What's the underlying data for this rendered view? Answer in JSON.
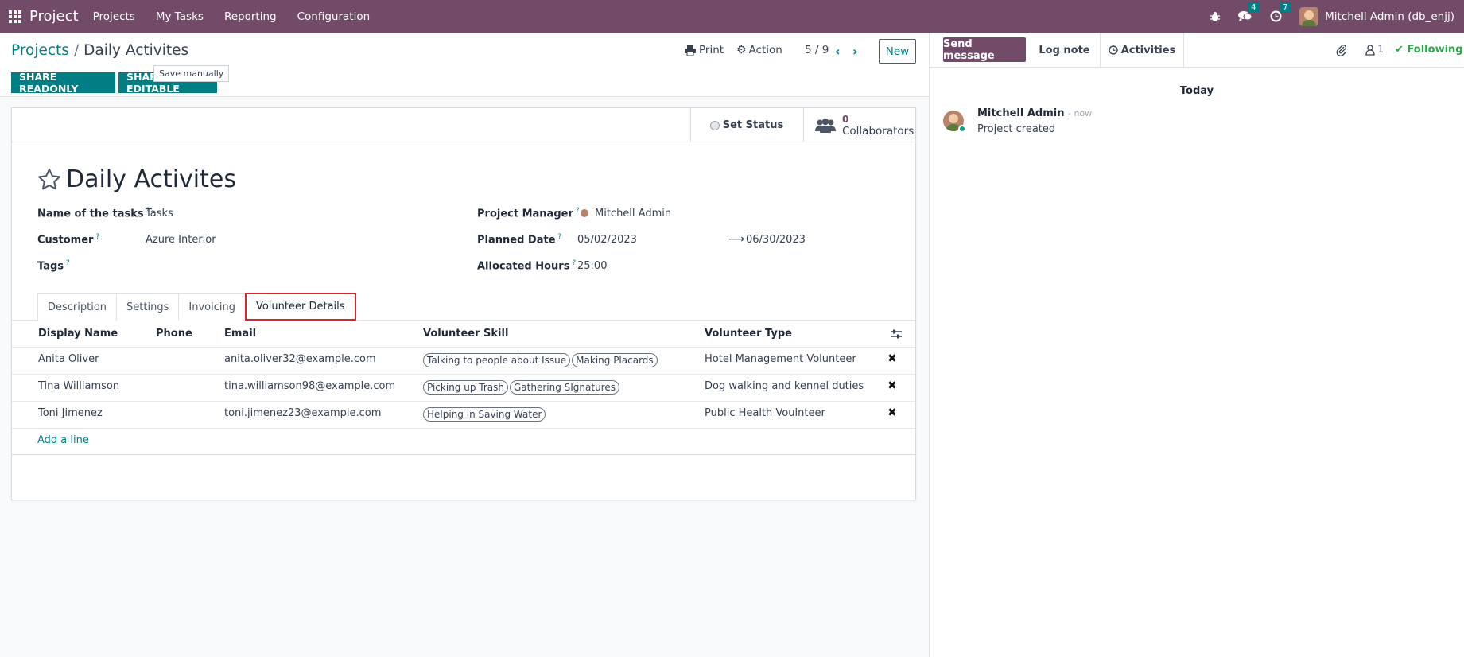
{
  "navbar": {
    "brand": "Project",
    "menu": [
      "Projects",
      "My Tasks",
      "Reporting",
      "Configuration"
    ],
    "messages_count": "4",
    "activities_count": "7",
    "user": "Mitchell Admin (db_enjj)"
  },
  "control": {
    "breadcrumb_parent": "Projects",
    "breadcrumb_sep": "/",
    "breadcrumb_current": "Daily Activites",
    "tooltip": "Save manually",
    "share_readonly": "SHARE READONLY",
    "share_editable": "SHARE EDITABLE",
    "print": "Print",
    "action": "Action",
    "pager": "5 / 9",
    "new": "New"
  },
  "sheet": {
    "set_status": "Set Status",
    "collaborators_count": "0",
    "collaborators_label": "Collaborators",
    "title": "Daily Activites",
    "fields": {
      "tasks_label": "Name of the tasks",
      "tasks_value": "Tasks",
      "customer_label": "Customer",
      "customer_value": "Azure Interior",
      "tags_label": "Tags",
      "pm_label": "Project Manager",
      "pm_value": "Mitchell Admin",
      "planned_label": "Planned Date",
      "planned_start": "05/02/2023",
      "planned_end": "06/30/2023",
      "hours_label": "Allocated Hours",
      "hours_value": "25:00",
      "help_mark": "?"
    },
    "tabs": [
      "Description",
      "Settings",
      "Invoicing",
      "Volunteer Details"
    ],
    "table": {
      "headers": [
        "Display Name",
        "Phone",
        "Email",
        "Volunteer Skill",
        "Volunteer Type"
      ],
      "rows": [
        {
          "name": "Anita Oliver",
          "phone": "",
          "email": "anita.oliver32@example.com",
          "skills": [
            "Talking to people about Issue",
            "Making Placards"
          ],
          "type": "Hotel Management Volunteer"
        },
        {
          "name": "Tina Williamson",
          "phone": "",
          "email": "tina.williamson98@example.com",
          "skills": [
            "Picking up Trash",
            "Gathering SIgnatures"
          ],
          "type": "Dog walking and kennel duties"
        },
        {
          "name": "Toni Jimenez",
          "phone": "",
          "email": "toni.jimenez23@example.com",
          "skills": [
            "Helping in Saving Water"
          ],
          "type": "Public Health Voulnteer"
        }
      ],
      "add_line": "Add a line"
    }
  },
  "chatter": {
    "send_message": "Send message",
    "log_note": "Log note",
    "activities": "Activities",
    "followers_count": "1",
    "following": "Following",
    "today": "Today",
    "message": {
      "author": "Mitchell Admin",
      "time": "- now",
      "body": "Project created"
    }
  },
  "colors": {
    "brand": "#714b67",
    "accent": "#017e84",
    "highlight": "#d9262d"
  }
}
